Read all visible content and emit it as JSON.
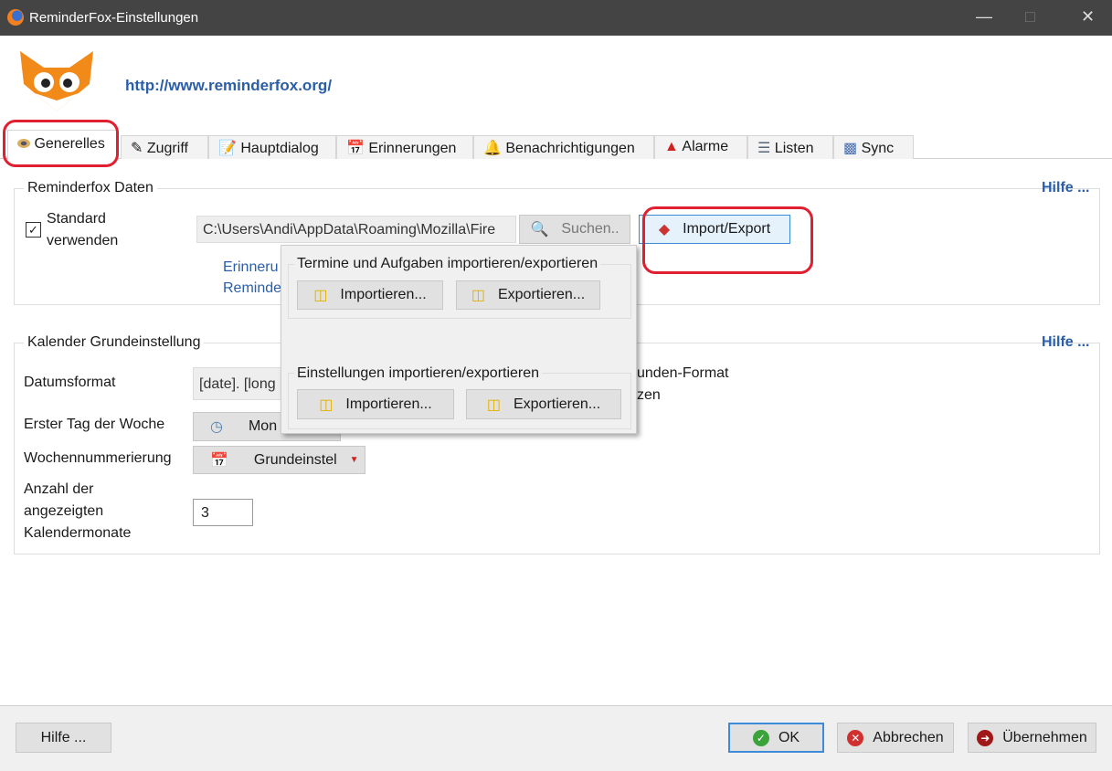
{
  "window": {
    "title": "ReminderFox-Einstellungen"
  },
  "header": {
    "url": "http://www.reminderfox.org/"
  },
  "tabs": [
    "Generelles",
    "Zugriff",
    "Hauptdialog",
    "Erinnerungen",
    "Benachrichtigungen",
    "Alarme",
    "Listen",
    "Sync"
  ],
  "data_group": {
    "title": "Reminderfox Daten",
    "help": "Hilfe ...",
    "checkbox_label_1": "Standard",
    "checkbox_label_2": "verwenden",
    "path": "C:\\Users\\Andi\\AppData\\Roaming\\Mozilla\\Fire",
    "search": "Suchen..",
    "import_export": "Import/Export",
    "link1": "Erinneru",
    "link2": "Reminde"
  },
  "popup": {
    "group1": "Termine und Aufgaben importieren/exportieren",
    "group2": "Einstellungen importieren/exportieren",
    "import": "Importieren...",
    "export": "Exportieren..."
  },
  "calendar_group": {
    "title": "Kalender Grundeinstellung",
    "help": "Hilfe ...",
    "date_label": "Datumsformat",
    "date_value": "[date].  [long",
    "hour_format": "unden-Format",
    "hour_format2": "zen",
    "first_day_label": "Erster Tag der Woche",
    "first_day_value": "Mon",
    "week_num_label": "Wochennummerierung",
    "week_num_value": "Grundeinstel",
    "months_label_1": "Anzahl der",
    "months_label_2": "angezeigten",
    "months_label_3": "Kalendermonate",
    "months_value": "3"
  },
  "footer": {
    "help": "Hilfe ...",
    "ok": "OK",
    "cancel": "Abbrechen",
    "apply": "Übernehmen"
  }
}
